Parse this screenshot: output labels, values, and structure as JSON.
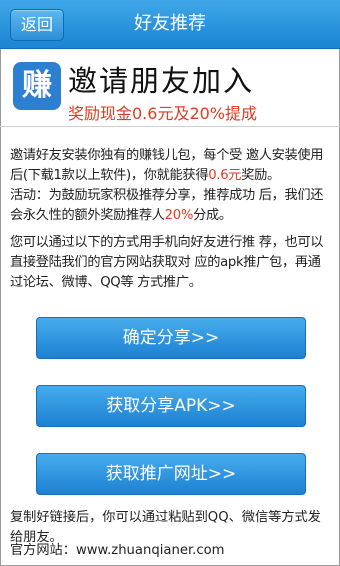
{
  "header": {
    "back_label": "返回",
    "title": "好友推荐"
  },
  "app": {
    "icon_char": "赚",
    "headline": "邀请朋友加入",
    "reward": "奖励现金0.6元及20%提成"
  },
  "intro": {
    "p1a": "邀请好友安装你独有的赚钱儿包，每个受 邀人安装使用后(下载1款以上软件)，你就能获得",
    "p1_amount": "0.6元",
    "p1b": "奖励。",
    "p2a": "活动：为鼓励玩家积极推荐分享，推荐成功 后，我们还会永久性的额外奖励推荐人",
    "p2_percent": "20%",
    "p2b": "分成。",
    "p3": "您可以通过以下的方式用手机向好友进行推 荐，也可以直接登陆我们的官方网站获取对 应的apk推广包，再通过论坛、微博、QQ等 方式推广。"
  },
  "buttons": {
    "share": "确定分享>>",
    "get_apk": "获取分享APK>>",
    "get_link": "获取推广网址>>"
  },
  "footer": {
    "tip": "复制好链接后，你可以通过粘贴到QQ、微信等方式发给朋友。",
    "site_label": "官方网站：",
    "site_url": "www.zhuanqianer.com"
  }
}
